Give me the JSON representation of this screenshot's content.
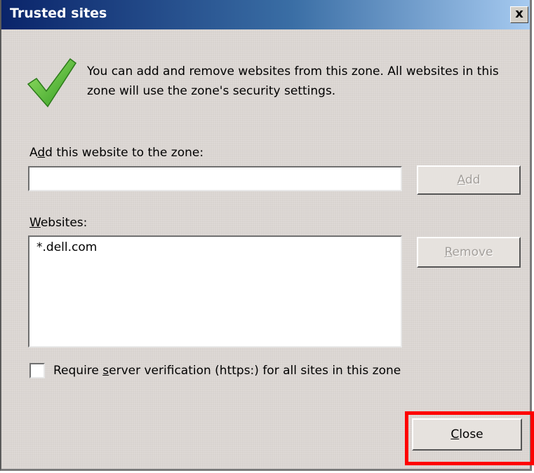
{
  "window": {
    "title": "Trusted sites",
    "close_glyph": "x"
  },
  "info": {
    "icon": "checkmark-icon",
    "text": "You can add and remove websites from this zone. All websites in this zone will use the zone's security settings."
  },
  "add_section": {
    "label_pre": "A",
    "label_mnemonic": "d",
    "label_post": "d this website to the zone:",
    "input_value": "",
    "add_button": {
      "mnemonic": "A",
      "rest": "dd",
      "enabled": false
    }
  },
  "websites": {
    "label_mnemonic": "W",
    "label_post": "ebsites:",
    "items": [
      "*.dell.com"
    ],
    "remove_button": {
      "mnemonic": "R",
      "rest": "emove",
      "enabled": false
    }
  },
  "verification": {
    "checked": false,
    "label_pre": "Require ",
    "label_mnemonic": "s",
    "label_post": "erver verification (https:) for all sites in this zone"
  },
  "close_button": {
    "mnemonic": "C",
    "rest": "lose"
  },
  "colors": {
    "highlight": "#ff0000",
    "title_start": "#0a246a",
    "title_end": "#a6caf0",
    "face": "#d8d3cf"
  }
}
